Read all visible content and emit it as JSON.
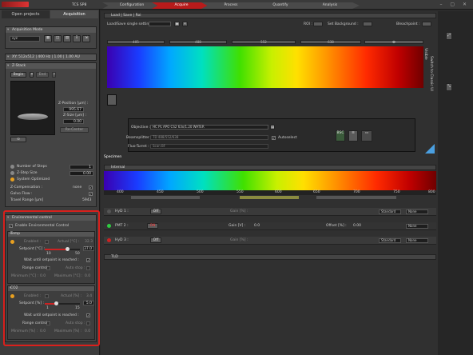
{
  "topbar": {
    "system": "TCS SP8",
    "window_controls": "– ▢ ✕"
  },
  "left_tabs": [
    "Open projects",
    "Acquisition"
  ],
  "acquisition_mode": {
    "title": "Acquisition Mode",
    "mode": "xyz"
  },
  "xy_section": {
    "title": "XY: 512x512 | 400 Hz | 1.00 | 1.00 AU"
  },
  "zstack": {
    "title": "Z-Stack",
    "begin_label": "Begin",
    "end_label": "End",
    "z_position_label": "Z-Position [µm] :",
    "z_position_value": "995.67",
    "z_size_label": "Z-Size [µm] :",
    "z_size_value": "0.00",
    "recenter_label": "Re-Center",
    "number_of_steps_label": "Number of Steps",
    "number_of_steps_value": "1",
    "z_step_size_label": "Z-Step Size",
    "z_step_size_value": "0.00",
    "system_optimized_label": "System Optimized",
    "z_compensation_label": "Z-Compensation :",
    "z_compensation_value": "none",
    "galvo_flow_label": "Galvo Flow :",
    "travel_range_label": "Travel Range [µm]",
    "travel_range_value": "5943"
  },
  "environmental": {
    "title": "Environmental control",
    "enable_label": "Enable Environmental Control",
    "temp": {
      "title": "Temp",
      "enabled_label": "Enabled :",
      "actual_label": "Actual [°C] :",
      "actual_value": "32.3",
      "setpoint_label": "Setpoint [°C] :",
      "setpoint_value": "37.0",
      "min_tick": "10",
      "max_tick": "50",
      "wait_label": "Wait until setpoint is reached :",
      "range_control_label": "Range control :",
      "auto_stop_label": "Auto stop :",
      "minimum_label": "Minimum [°C] :",
      "minimum_value": "0.0",
      "maximum_label": "Maximum [°C] :",
      "maximum_value": "0.0"
    },
    "co2": {
      "title": "CO2",
      "enabled_label": "Enabled :",
      "actual_label": "Actual [%] :",
      "actual_value": "3.4",
      "setpoint_label": "Setpoint [%] :",
      "setpoint_value": "5.0",
      "min_tick": "1",
      "max_tick": "15",
      "wait_label": "Wait until setpoint is reached :",
      "range_control_label": "Range control :",
      "auto_stop_label": "Auto stop :",
      "minimum_label": "Minimum [%] :",
      "minimum_value": "0.0",
      "maximum_label": "Maximum [%] :",
      "maximum_value": "0.0"
    }
  },
  "nav_tabs": [
    "Configuration",
    "Acquire",
    "Process",
    "Quantify",
    "Analysis"
  ],
  "nav_active": 1,
  "load_panel": {
    "title": "Load | Save | Roi",
    "single_setting": "Load/Save single setting :",
    "roi_label": "ROI :",
    "set_background_label": "Set Background :",
    "bleachpoint_label": "Bleachpoint :"
  },
  "laser_lines": [
    "405",
    "488",
    "552",
    "638"
  ],
  "visible_label": "Visible",
  "switch_label": "Switch to Classic UI",
  "objective": {
    "objective_label": "Objective :",
    "objective_value": "HC PL APO CS2  63x/1.20 WATER",
    "beamsplitter_label": "Beamsplitter :",
    "beamsplitter_value": "TD 488/552/638",
    "fluo_turret_label": "Fluo-Turret :",
    "fluo_turret_value": "Scan BF",
    "autoselect_label": "Autoselect",
    "bsc_label": "BSC"
  },
  "specimen_label": "Specimen",
  "internal": {
    "title": "Internal",
    "scale": [
      "400",
      "450",
      "500",
      "550",
      "600",
      "650",
      "700",
      "750",
      "800"
    ],
    "detectors": [
      {
        "name": "HyD 1 :",
        "state": "Off",
        "gain_label": "Gain [%] :",
        "mode": "Standard",
        "none": "None",
        "color": "#555"
      },
      {
        "name": "PMT 2 :",
        "state": "ON",
        "gain_label": "Gain [V] :",
        "gain_value": "0.0",
        "offset_label": "Offset [%] :",
        "offset_value": "0.00",
        "none": "None",
        "color": "#2ecc40"
      },
      {
        "name": "HyD 3 :",
        "state": "Off",
        "gain_label": "Gain [%] :",
        "mode": "Standard",
        "none": "None",
        "color": "#c22"
      }
    ]
  },
  "tld_label": "TLD"
}
